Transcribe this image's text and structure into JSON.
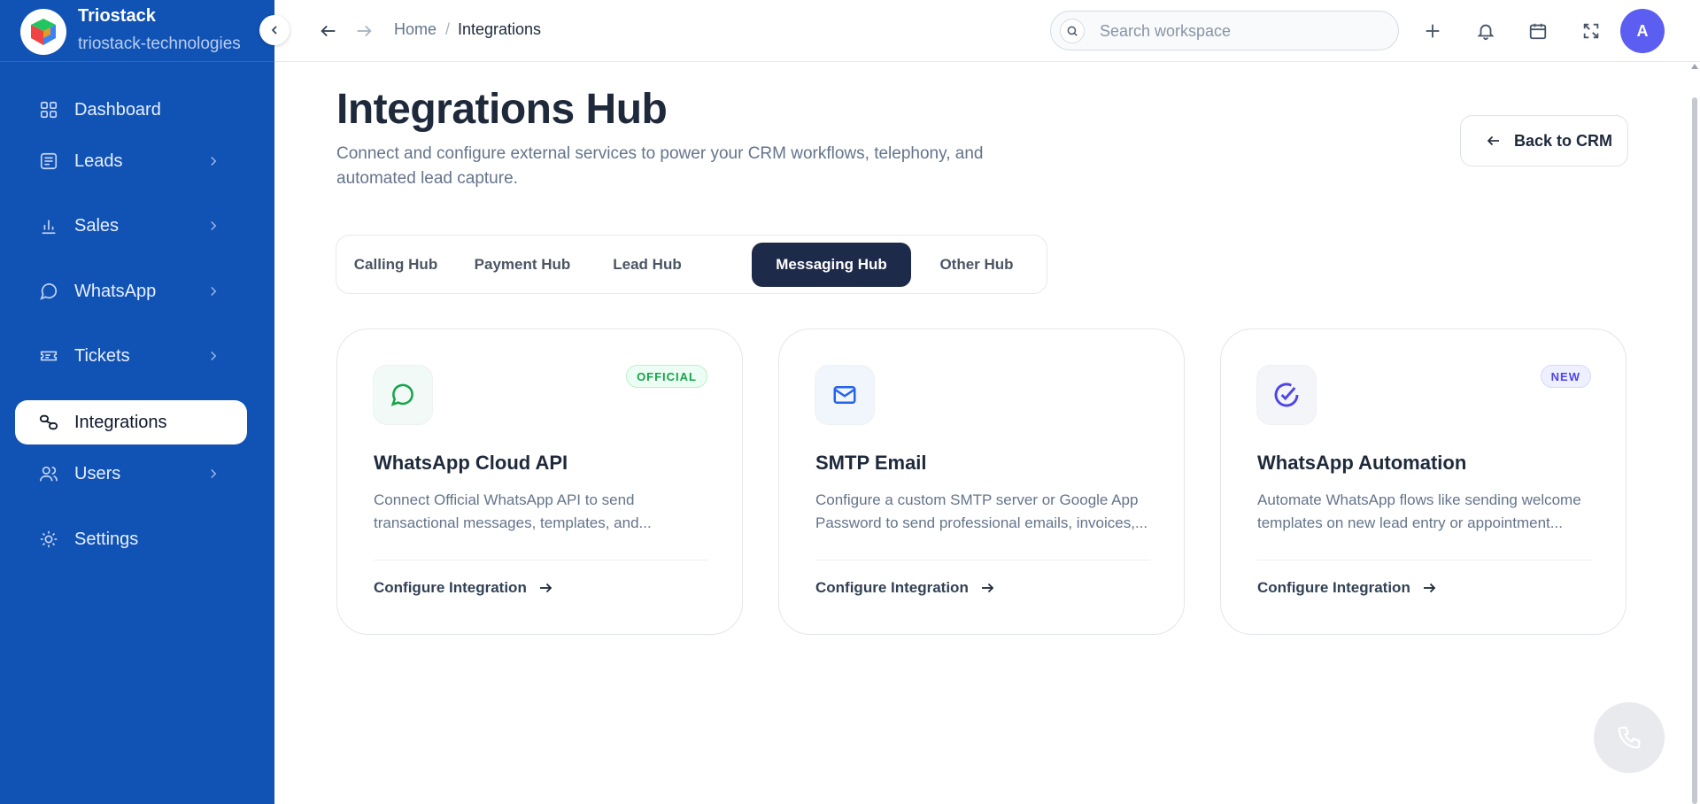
{
  "brand": {
    "name": "Triostack",
    "workspace": "triostack-technologies"
  },
  "sidebar": {
    "items": [
      {
        "label": "Dashboard",
        "icon": "grid-icon",
        "has_chevron": false
      },
      {
        "label": "Leads",
        "icon": "list-icon",
        "has_chevron": true
      },
      {
        "label": "Sales",
        "icon": "bar-chart-icon",
        "has_chevron": true
      },
      {
        "label": "WhatsApp",
        "icon": "chat-bubble-icon",
        "has_chevron": true
      },
      {
        "label": "Tickets",
        "icon": "ticket-icon",
        "has_chevron": true
      },
      {
        "label": "Integrations",
        "icon": "link-icon",
        "has_chevron": false,
        "active": true
      },
      {
        "label": "Users",
        "icon": "users-icon",
        "has_chevron": true
      },
      {
        "label": "Settings",
        "icon": "sun-gear-icon",
        "has_chevron": false
      }
    ]
  },
  "header": {
    "breadcrumb": [
      "Home",
      "Integrations"
    ],
    "breadcrumb_separator": "/",
    "search_placeholder": "Search workspace",
    "avatar_initial": "A"
  },
  "main": {
    "title": "Integrations Hub",
    "description": "Connect and configure external services to power your CRM workflows, telephony, and automated lead capture.",
    "back_button": "Back to CRM",
    "tabs": [
      {
        "label": "Calling Hub",
        "active": false
      },
      {
        "label": "Payment Hub",
        "active": false
      },
      {
        "label": "Lead Hub",
        "active": false
      },
      {
        "label": "Messaging Hub",
        "active": true
      },
      {
        "label": "Other Hub",
        "active": false
      }
    ],
    "cards": [
      {
        "title": "WhatsApp Cloud API",
        "description": "Connect Official WhatsApp API to send transactional messages, templates, and...",
        "badge": "OFFICIAL",
        "icon": "whatsapp-chat-icon",
        "action": "Configure Integration"
      },
      {
        "title": "SMTP Email",
        "description": "Configure a custom SMTP server or Google App Password to send professional emails, invoices,...",
        "badge": "",
        "icon": "mail-icon",
        "action": "Configure Integration"
      },
      {
        "title": "WhatsApp Automation",
        "description": "Automate WhatsApp flows like sending welcome templates on new lead entry or appointment...",
        "badge": "NEW",
        "icon": "check-circle-icon",
        "action": "Configure Integration"
      }
    ]
  },
  "colors": {
    "sidebar_bg": "#1153b5",
    "active_tab_bg": "#1e2a4a",
    "avatar_bg": "#5b5ef0",
    "official_badge": "#16a34a",
    "new_badge": "#4f46e5"
  }
}
